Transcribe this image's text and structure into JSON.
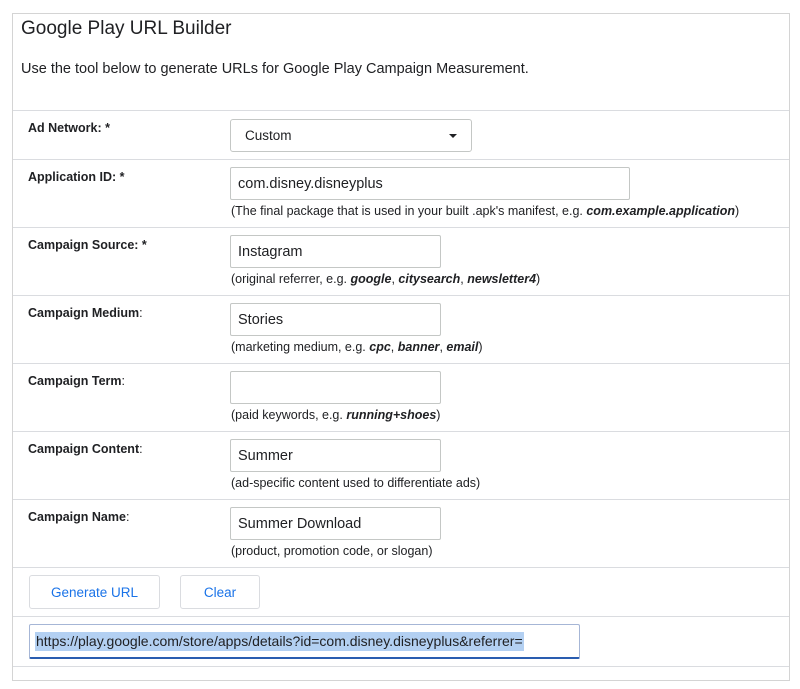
{
  "header": {
    "title": "Google Play URL Builder",
    "intro": "Use the tool below to generate URLs for Google Play Campaign Measurement."
  },
  "fields": {
    "ad_network": {
      "label": "Ad Network",
      "required_mark": ": *",
      "selected": "Custom"
    },
    "application_id": {
      "label": "Application ID",
      "required_mark": ": *",
      "value": "com.disney.disneyplus",
      "hint_prefix": "(The final package that is used in your built .apk's manifest, e.g. ",
      "hint_example": "com.example.application",
      "hint_suffix": ")"
    },
    "campaign_source": {
      "label": "Campaign Source",
      "required_mark": ": *",
      "value": "Instagram",
      "hint_prefix": "(original referrer, e.g. ",
      "hint_examples": [
        "google",
        "citysearch",
        "newsletter4"
      ],
      "hint_suffix": ")"
    },
    "campaign_medium": {
      "label": "Campaign Medium",
      "suffix": ":",
      "value": "Stories",
      "hint_prefix": "(marketing medium, e.g. ",
      "hint_examples": [
        "cpc",
        "banner",
        "email"
      ],
      "hint_suffix": ")"
    },
    "campaign_term": {
      "label": "Campaign Term",
      "suffix": ":",
      "value": "",
      "hint_prefix": "(paid keywords, e.g. ",
      "hint_example": "running+shoes",
      "hint_suffix": ")"
    },
    "campaign_content": {
      "label": "Campaign Content",
      "suffix": ":",
      "value": "Summer",
      "hint": "(ad-specific content used to differentiate ads)"
    },
    "campaign_name": {
      "label": "Campaign Name",
      "suffix": ":",
      "value": "Summer Download",
      "hint": "(product, promotion code, or slogan)"
    }
  },
  "actions": {
    "generate_label": "Generate URL",
    "clear_label": "Clear"
  },
  "result": {
    "url": "https://play.google.com/store/apps/details?id=com.disney.disneyplus&referrer="
  },
  "colors": {
    "accent": "#1a73e8",
    "border": "#dadce0",
    "selection": "#b3d0f2"
  }
}
